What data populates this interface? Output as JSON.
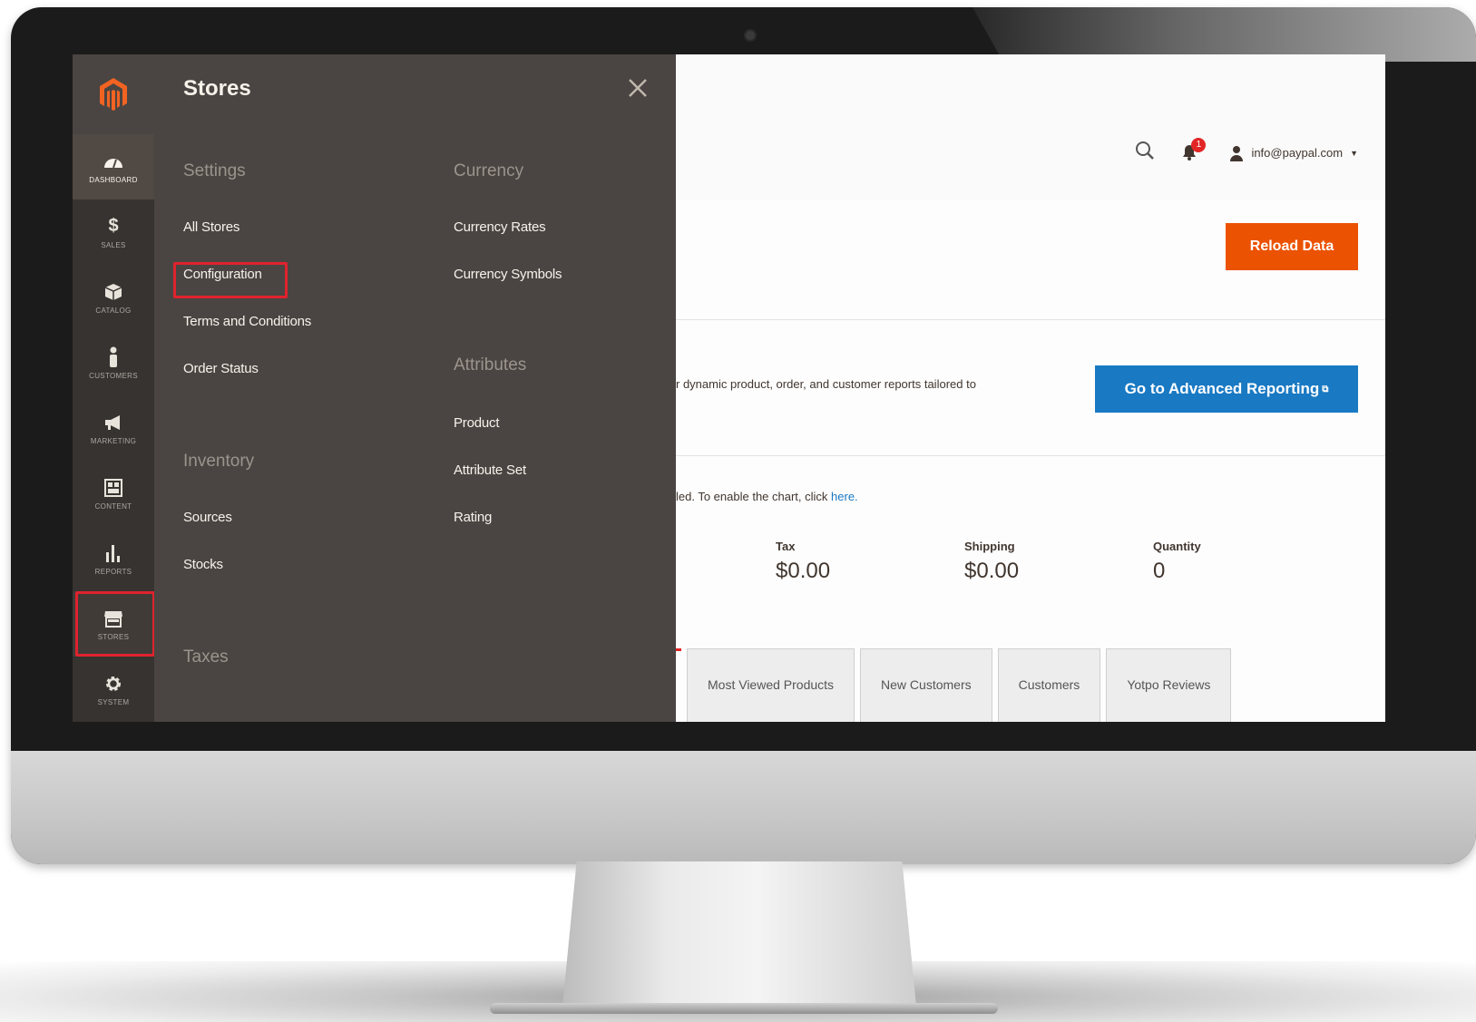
{
  "admin_nav": {
    "items": [
      {
        "label": "Dashboard",
        "icon": "dashboard-icon"
      },
      {
        "label": "Sales",
        "icon": "dollar-icon"
      },
      {
        "label": "Catalog",
        "icon": "box-icon"
      },
      {
        "label": "Customers",
        "icon": "person-icon"
      },
      {
        "label": "Marketing",
        "icon": "megaphone-icon"
      },
      {
        "label": "Content",
        "icon": "layout-icon"
      },
      {
        "label": "Reports",
        "icon": "bar-chart-icon"
      },
      {
        "label": "Stores",
        "icon": "store-icon"
      },
      {
        "label": "System",
        "icon": "gear-icon"
      }
    ]
  },
  "flyout": {
    "title": "Stores",
    "settings": {
      "title": "Settings",
      "links": [
        "All Stores",
        "Configuration",
        "Terms and Conditions",
        "Order Status"
      ]
    },
    "inventory": {
      "title": "Inventory",
      "links": [
        "Sources",
        "Stocks"
      ]
    },
    "taxes": {
      "title": "Taxes"
    },
    "currency": {
      "title": "Currency",
      "links": [
        "Currency Rates",
        "Currency Symbols"
      ]
    },
    "attributes": {
      "title": "Attributes",
      "links": [
        "Product",
        "Attribute Set",
        "Rating"
      ]
    }
  },
  "header": {
    "user_email": "info@paypal.com"
  },
  "dashboard": {
    "reload_label": "Reload Data",
    "advanced_text": "r dynamic product, order, and customer reports tailored to",
    "advanced_button": "Go to Advanced Reporting",
    "chart_note": "led. To enable the chart, click ",
    "chart_note_link": "here.",
    "stats": [
      {
        "label": "Tax",
        "value": "$0.00"
      },
      {
        "label": "Shipping",
        "value": "$0.00"
      },
      {
        "label": "Quantity",
        "value": "0"
      }
    ],
    "tabs": [
      "Most Viewed Products",
      "New Customers",
      "Customers",
      "Yotpo Reviews"
    ]
  },
  "colors": {
    "accent_orange": "#eb5202",
    "accent_blue": "#1979c3",
    "highlight_red": "#e0222e",
    "nav_bg": "#373330",
    "flyout_bg": "#4a4542"
  }
}
